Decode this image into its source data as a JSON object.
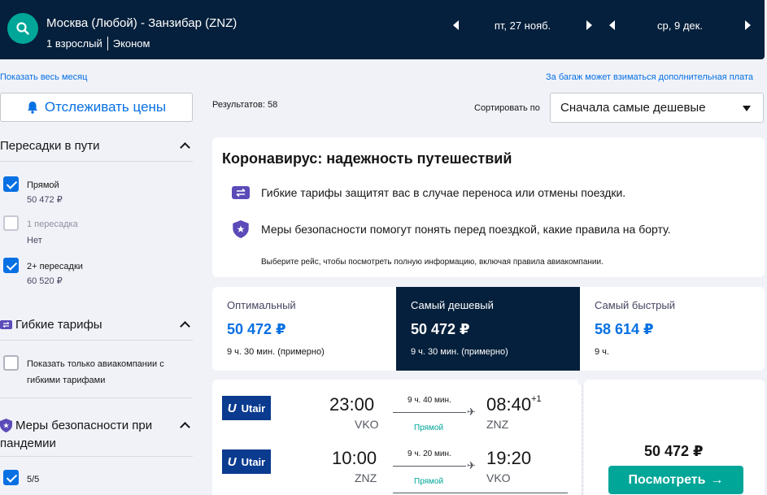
{
  "header": {
    "route": "Москва (Любой) - Занзибар (ZNZ)",
    "passengers": "1 взрослый",
    "cabin": "Эконом",
    "depart_date": "пт, 27 нояб.",
    "return_date": "ср, 9 дек."
  },
  "links": {
    "show_month": "Показать весь месяц",
    "baggage": "За багаж может взиматься дополнительная плата"
  },
  "sidebar": {
    "track_prices": "Отслеживать цены",
    "stops": {
      "title": "Пересадки в пути",
      "options": [
        {
          "label": "Прямой",
          "sub": "50 472 ₽",
          "checked": true
        },
        {
          "label": "1 пересадка",
          "sub": "Нет",
          "checked": false
        },
        {
          "label": "2+ пересадки",
          "sub": "60 520 ₽",
          "checked": true
        }
      ]
    },
    "flex": {
      "title": "Гибкие тарифы",
      "option_line1": "Показать только авиакомпании с",
      "option_line2": "гибкими тарифами"
    },
    "safety": {
      "title_line1": "Меры безопасности при",
      "title_line2": "пандемии",
      "option": "5/5"
    }
  },
  "main": {
    "results": "Результатов: 58",
    "sort_label": "Сортировать по",
    "sort_value": "Сначала самые дешевые",
    "covid": {
      "title": "Коронавирус: надежность путешествий",
      "item1": "Гибкие тарифы защитят вас в случае переноса или отмены поездки.",
      "item2": "Меры безопасности помогут понять перед поездкой, какие правила на борту.",
      "note": "Выберите рейс, чтобы посмотреть полную информацию, включая правила авиакомпании."
    },
    "tabs": [
      {
        "name": "Оптимальный",
        "price": "50 472 ₽",
        "duration": "9 ч. 30 мин. (примерно)"
      },
      {
        "name": "Самый дешевый",
        "price": "50 472 ₽",
        "duration": "9 ч. 30 мин. (примерно)"
      },
      {
        "name": "Самый быстрый",
        "price": "58 614 ₽",
        "duration": "9 ч."
      }
    ],
    "result": {
      "legs": [
        {
          "airline": "Utair",
          "dep_time": "23:00",
          "dep_airport": "VKO",
          "duration": "9 ч. 40 мин.",
          "stops": "Прямой",
          "arr_time": "08:40",
          "arr_plus": "+1",
          "arr_airport": "ZNZ"
        },
        {
          "airline": "Utair",
          "dep_time": "10:00",
          "dep_airport": "ZNZ",
          "duration": "9 ч. 20 мин.",
          "stops": "Прямой",
          "arr_time": "19:20",
          "arr_plus": "",
          "arr_airport": "VKO"
        }
      ],
      "price": "50 472 ₽",
      "view_button": "Посмотреть"
    }
  },
  "colors": {
    "header_bg": "#05203c",
    "accent": "#0770e3",
    "teal": "#00a698"
  }
}
